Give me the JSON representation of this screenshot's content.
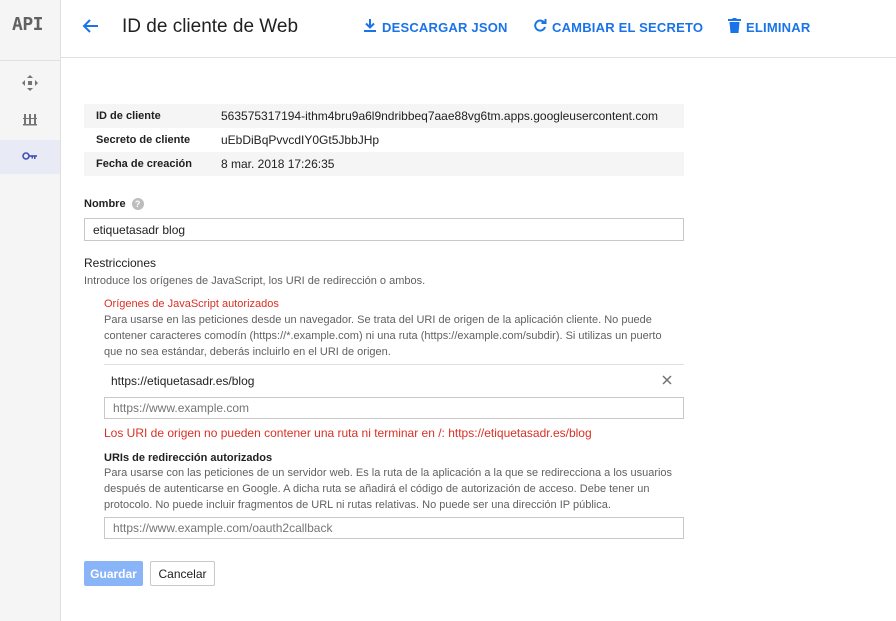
{
  "app": {
    "logo": "API"
  },
  "sidebar": {
    "items": [
      {
        "icon": "move-arrows-icon"
      },
      {
        "icon": "library-icon"
      },
      {
        "icon": "key-icon",
        "active": true
      }
    ]
  },
  "header": {
    "title": "ID de cliente de Web",
    "actions": {
      "download": "DESCARGAR JSON",
      "reset_secret": "CAMBIAR EL SECRETO",
      "delete": "ELIMINAR"
    }
  },
  "client_info": [
    {
      "label": "ID de cliente",
      "value": "563575317194-ithm4bru9a6l9ndribbeq7aae88vg6tm.apps.googleusercontent.com"
    },
    {
      "label": "Secreto de cliente",
      "value": "uEbDiBqPvvcdIY0Gt5JbbJHp"
    },
    {
      "label": "Fecha de creación",
      "value": "8 mar. 2018 17:26:35"
    }
  ],
  "name_field": {
    "label": "Nombre",
    "help": "?",
    "value": "etiquetasadr blog"
  },
  "restrictions": {
    "title": "Restricciones",
    "description": "Introduce los orígenes de JavaScript, los URI de redirección o ambos.",
    "js_origins": {
      "title": "Orígenes de JavaScript autorizados",
      "desc_lines": [
        "Para usarse en las peticiones desde un navegador. Se trata del URI de origen de la aplicación cliente. No puede",
        "contener caracteres comodín (https://*.example.com) ni una ruta (https://example.com/subdir). Si utilizas un puerto",
        "que no sea estándar, deberás incluirlo en el URI de origen."
      ],
      "entries": [
        "https://etiquetasadr.es/blog"
      ],
      "placeholder": "https://www.example.com",
      "error": "Los URI de origen no pueden contener una ruta ni terminar en /: https://etiquetasadr.es/blog"
    },
    "redirect_uris": {
      "title": "URIs de redirección autorizados",
      "desc_lines": [
        "Para usarse con las peticiones de un servidor web. Es la ruta de la aplicación a la que se redirecciona a los usuarios",
        "después de autenticarse en Google. A dicha ruta se añadirá el código de autorización de acceso. Debe tener un",
        "protocolo. No puede incluir fragmentos de URL ni rutas relativas. No puede ser una dirección IP pública."
      ],
      "placeholder": "https://www.example.com/oauth2callback"
    }
  },
  "buttons": {
    "save": "Guardar",
    "cancel": "Cancelar"
  },
  "colors": {
    "accent": "#1a73e8",
    "error": "#d93025",
    "save_disabled": "#8ab4f8"
  }
}
